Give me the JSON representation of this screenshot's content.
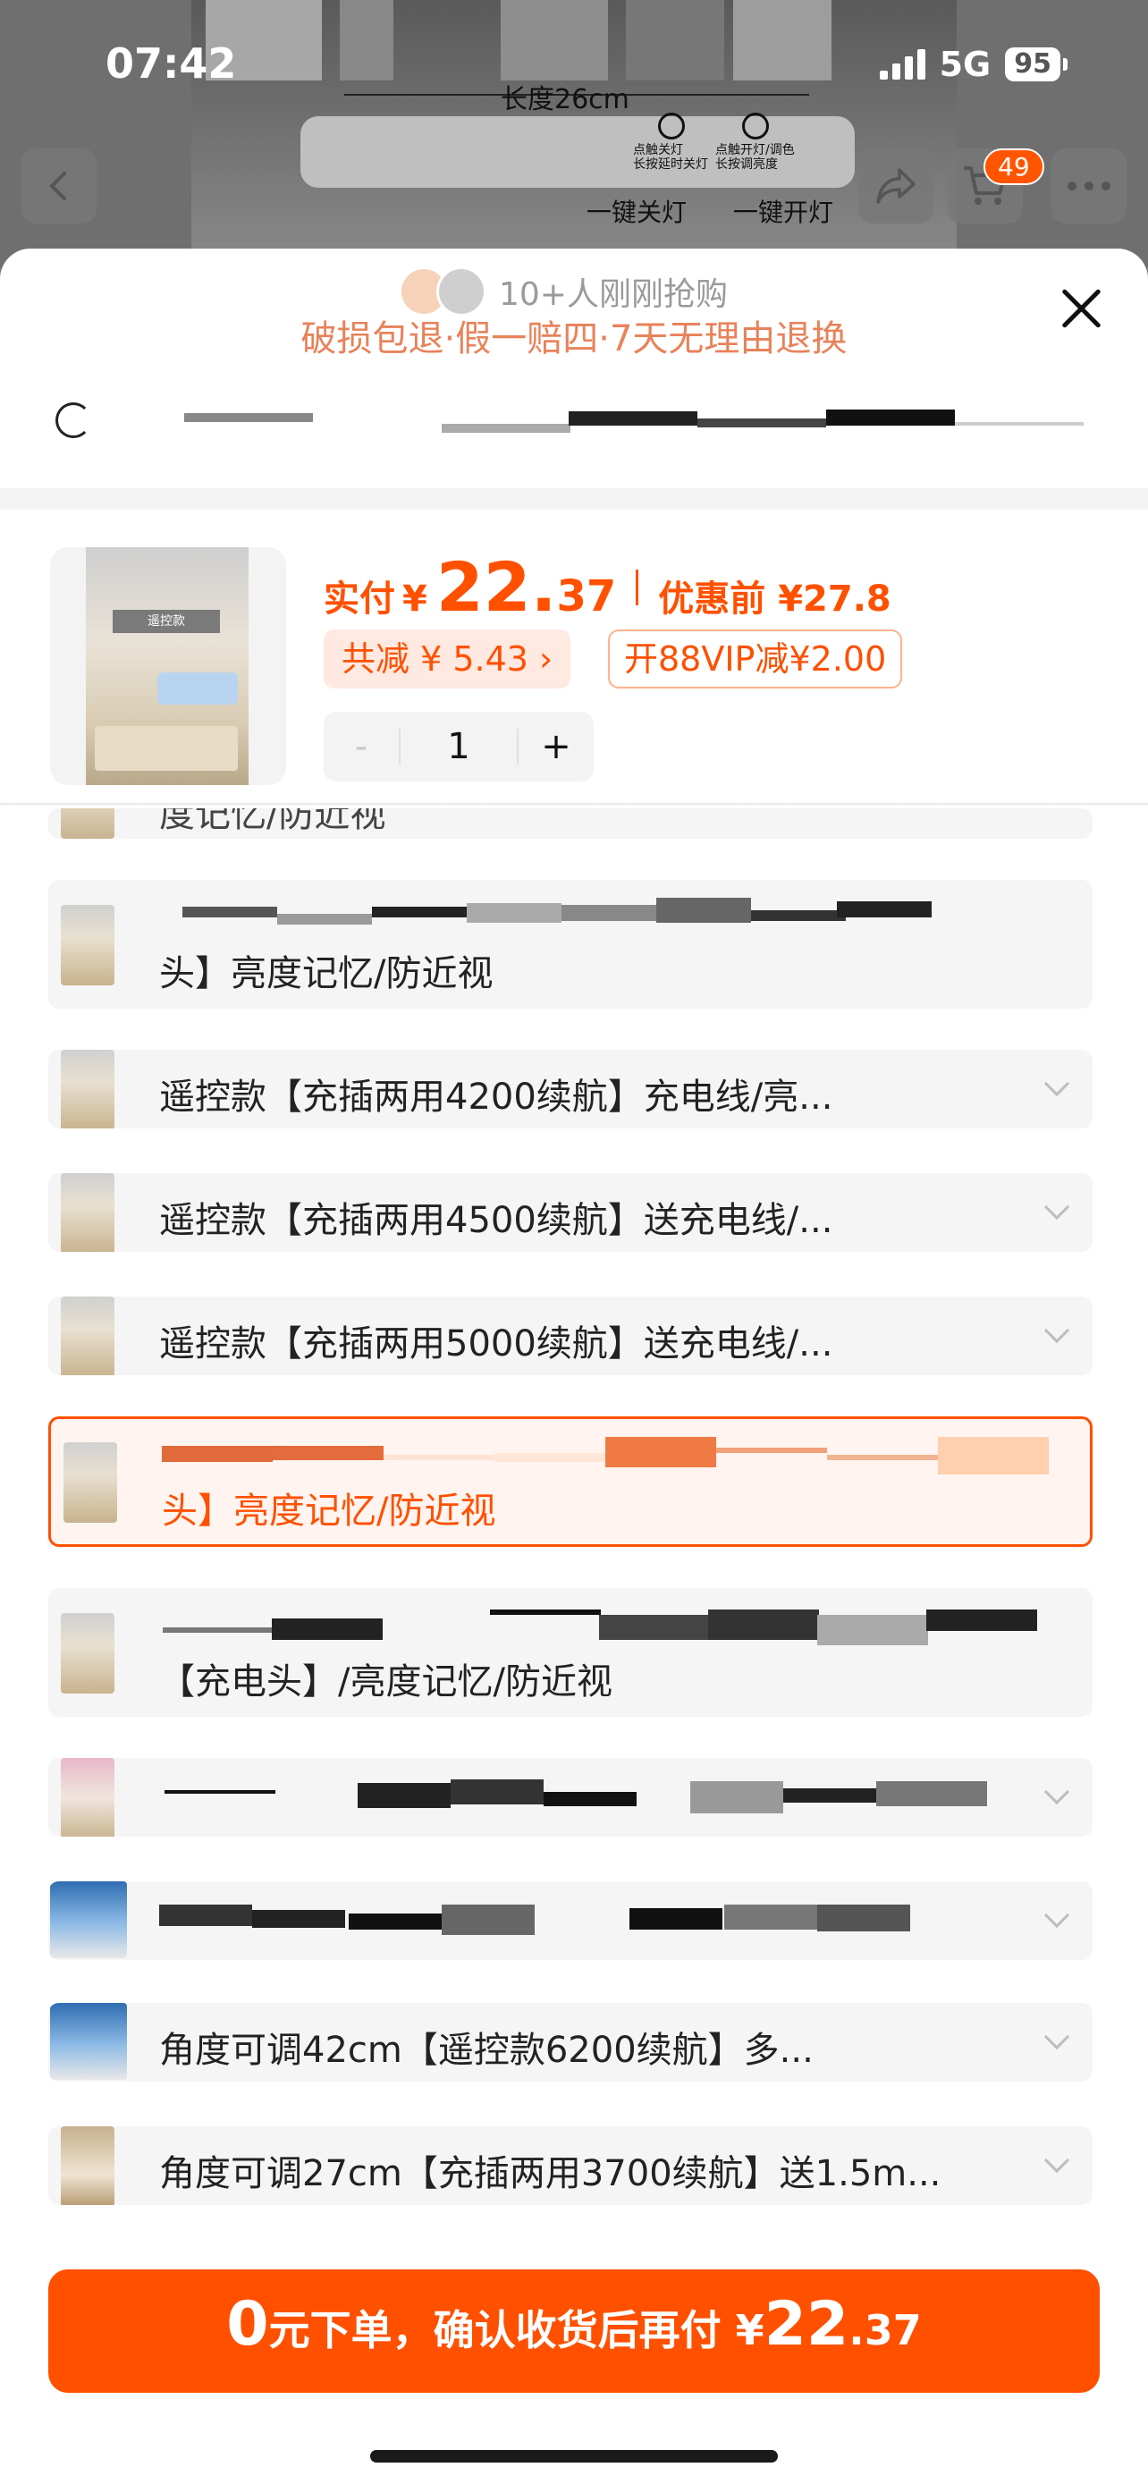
{
  "status_bar": {
    "time": "07:42",
    "network": "5G",
    "battery": "95"
  },
  "background": {
    "measure_label": "长度26cm",
    "power_left_label_1": "点触关灯",
    "power_left_label_2": "长按延时关灯",
    "power_right_label_1": "点触开灯/调色",
    "power_right_label_2": "长按调亮度",
    "key_off": "一键关灯",
    "key_on": "一键开灯",
    "cart_count": "49"
  },
  "sheet": {
    "buyers_text": "10+人刚刚抢购",
    "guarantee_text": "破损包退·假一赔四·7天无理由退换"
  },
  "product": {
    "thumb_tag": "遥控款",
    "price_label": "实付",
    "price_currency": "¥",
    "price_int": "22.",
    "price_dec": "37",
    "price_orig": "优惠前 ¥27.8",
    "discount_text": "共减 ¥ 5.43 ›",
    "vip_text": "开88VIP减¥2.00",
    "stepper": {
      "minus": "-",
      "value": "1",
      "plus": "+"
    }
  },
  "options": [
    {
      "text": "度记忆/防近视"
    },
    {
      "text": "头】亮度记忆/防近视"
    },
    {
      "text": "遥控款【充插两用4200续航】充电线/亮..."
    },
    {
      "text": "遥控款【充插两用4500续航】送充电线/..."
    },
    {
      "text": "遥控款【充插两用5000续航】送充电线/..."
    },
    {
      "text": "头】亮度记忆/防近视"
    },
    {
      "text": "【充电头】/亮度记忆/防近视"
    },
    {
      "text": ""
    },
    {
      "text": ""
    },
    {
      "text": "角度可调42cm【遥控款6200续航】多..."
    },
    {
      "text": "角度可调27cm【充插两用3700续航】送1.5m..."
    }
  ],
  "cta": {
    "zero": "0",
    "text": "元下单，确认收货后再付 ¥",
    "int": "22",
    "dec": ".37"
  },
  "colors": {
    "accent": "#ff5000",
    "accent_light": "#fff4ef",
    "guarantee": "#e8825a"
  }
}
